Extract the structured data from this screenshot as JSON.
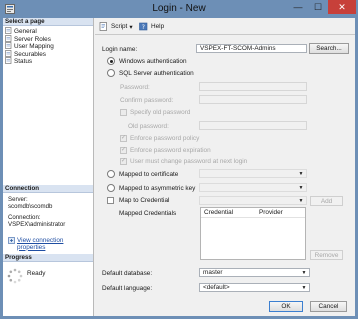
{
  "window": {
    "title": "Login - New",
    "minimize_glyph": "—",
    "maximize_glyph": "☐",
    "close_glyph": "✕"
  },
  "sidebar": {
    "select_page_header": "Select a page",
    "items": [
      {
        "label": "General",
        "icon": "page-icon"
      },
      {
        "label": "Server Roles",
        "icon": "page-icon"
      },
      {
        "label": "User Mapping",
        "icon": "page-icon"
      },
      {
        "label": "Securables",
        "icon": "page-icon"
      },
      {
        "label": "Status",
        "icon": "page-icon"
      }
    ],
    "connection_header": "Connection",
    "server_label": "Server:",
    "server_value": "scomdb\\scomdb",
    "connection_label": "Connection:",
    "connection_value": "VSPEX\\administrator",
    "view_connection_link": "View connection properties",
    "progress_header": "Progress",
    "progress_status": "Ready"
  },
  "toolbar": {
    "script_label": "Script",
    "script_arrow": "▾",
    "help_label": "Help"
  },
  "form": {
    "login_name_label": "Login name:",
    "login_name_value": "VSPEX-FT-SCOM-Admins",
    "search_button": "Search...",
    "windows_auth_label": "Windows authentication",
    "sql_auth_label": "SQL Server authentication",
    "password_label": "Password:",
    "confirm_password_label": "Confirm password:",
    "specify_old_password_label": "Specify old password",
    "old_password_label": "Old password:",
    "enforce_policy_label": "Enforce password policy",
    "enforce_expiration_label": "Enforce password expiration",
    "must_change_label": "User must change password at next login",
    "check_glyph": "✓",
    "mapped_certificate_label": "Mapped to certificate",
    "mapped_asymmetric_label": "Mapped to asymmetric key",
    "map_credential_label": "Map to Credential",
    "add_button": "Add",
    "mapped_credentials_label": "Mapped Credentials",
    "credential_columns": [
      "Credential",
      "Provider"
    ],
    "remove_button": "Remove",
    "default_database_label": "Default database:",
    "default_database_value": "master",
    "default_language_label": "Default language:",
    "default_language_value": "<default>",
    "dropdown_arrow": "▼"
  },
  "footer": {
    "ok_button": "OK",
    "cancel_button": "Cancel"
  },
  "colors": {
    "frame": "#6d8fb6",
    "close_button": "#c7403a",
    "link": "#1f4ea3"
  }
}
